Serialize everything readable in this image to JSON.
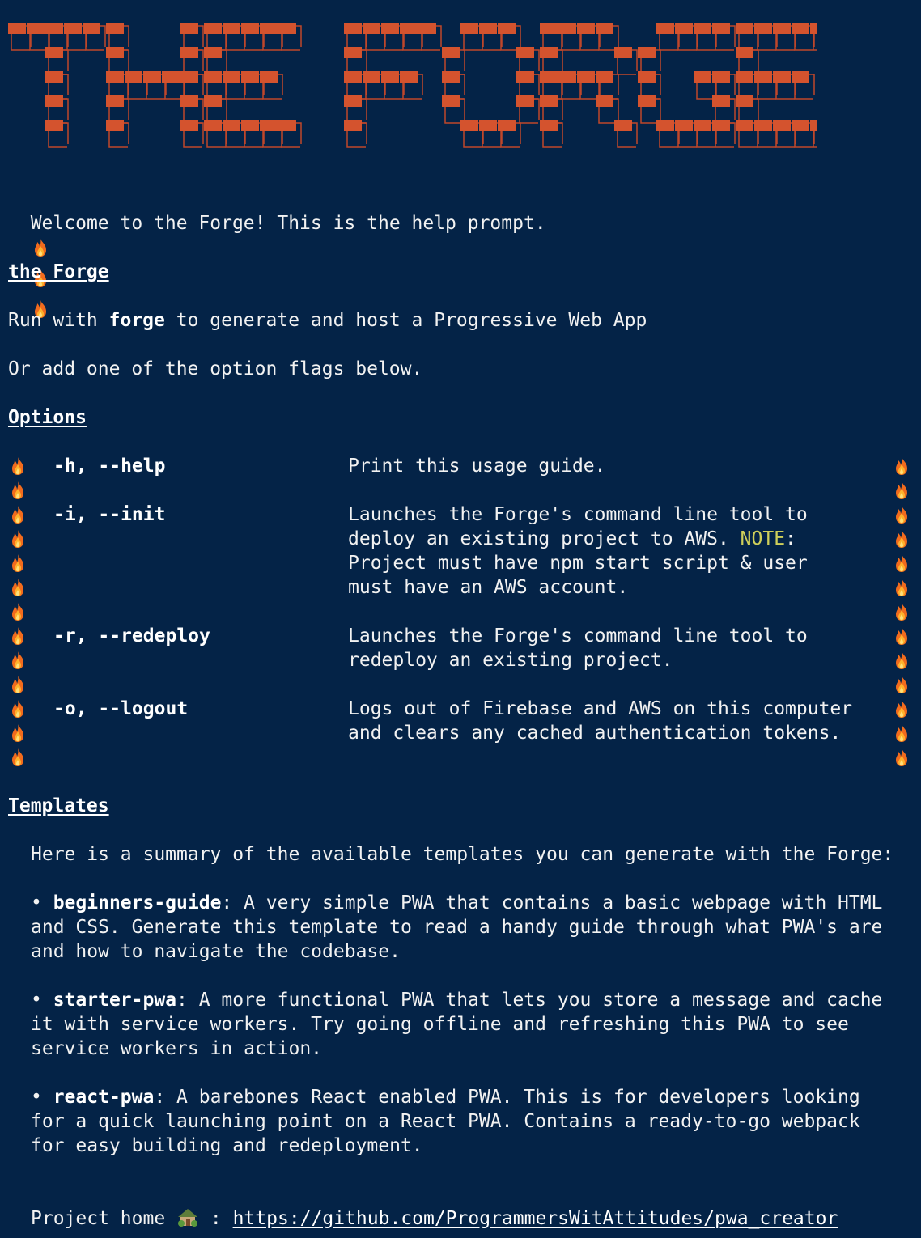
{
  "banner": {
    "text": "THE FORGE",
    "block_color": "#d4532e",
    "outline_color": "#c0472a"
  },
  "welcome": "Welcome to the Forge! This is the help prompt.",
  "section_main": {
    "heading": "the Forge",
    "run_prefix": "Run with ",
    "run_cmd": "forge",
    "run_suffix": " to generate and host a Progressive Web App",
    "or_line": "Or add one of the option flags below."
  },
  "options": {
    "heading": "Options",
    "items": [
      {
        "flag": "-h, --help",
        "lines": [
          "Print this usage guide."
        ]
      },
      {
        "flag": "-i, --init",
        "lines": [
          "Launches the Forge's command line tool to",
          "deploy an existing project to AWS. ",
          "Project must have npm start script & user",
          "must have an AWS account."
        ],
        "note": "NOTE",
        "note_suffix": ":"
      },
      {
        "flag": "-r, --redeploy",
        "lines": [
          "Launches the Forge's command line tool to",
          "redeploy an existing project."
        ]
      },
      {
        "flag": "-o, --logout",
        "lines": [
          "Logs out of Firebase and AWS on this computer",
          "and clears any cached authentication tokens."
        ]
      }
    ]
  },
  "templates": {
    "heading": "Templates",
    "intro": "Here is a summary of the available templates you can generate with the Forge:",
    "items": [
      {
        "name": "beginners-guide",
        "lines": [
          ": A very simple PWA that contains a basic webpage with HTML",
          "and CSS. Generate this template to read a handy guide through what PWA's are",
          "and how to navigate the codebase."
        ]
      },
      {
        "name": "starter-pwa",
        "lines": [
          ": A more functional PWA that lets you store a message and cache",
          "it with service workers. Try going offline and refreshing this PWA to see",
          "service workers in action."
        ]
      },
      {
        "name": "react-pwa",
        "lines": [
          ": A barebones React enabled PWA. This is for developers looking",
          "for a quick launching point on a React PWA. Contains a ready-to-go webpack",
          "for easy building and redeployment."
        ]
      }
    ]
  },
  "footer": {
    "label": "Project home",
    "sep": " : ",
    "url": "https://github.com/ProgrammersWitAttitudes/pwa_creator"
  }
}
